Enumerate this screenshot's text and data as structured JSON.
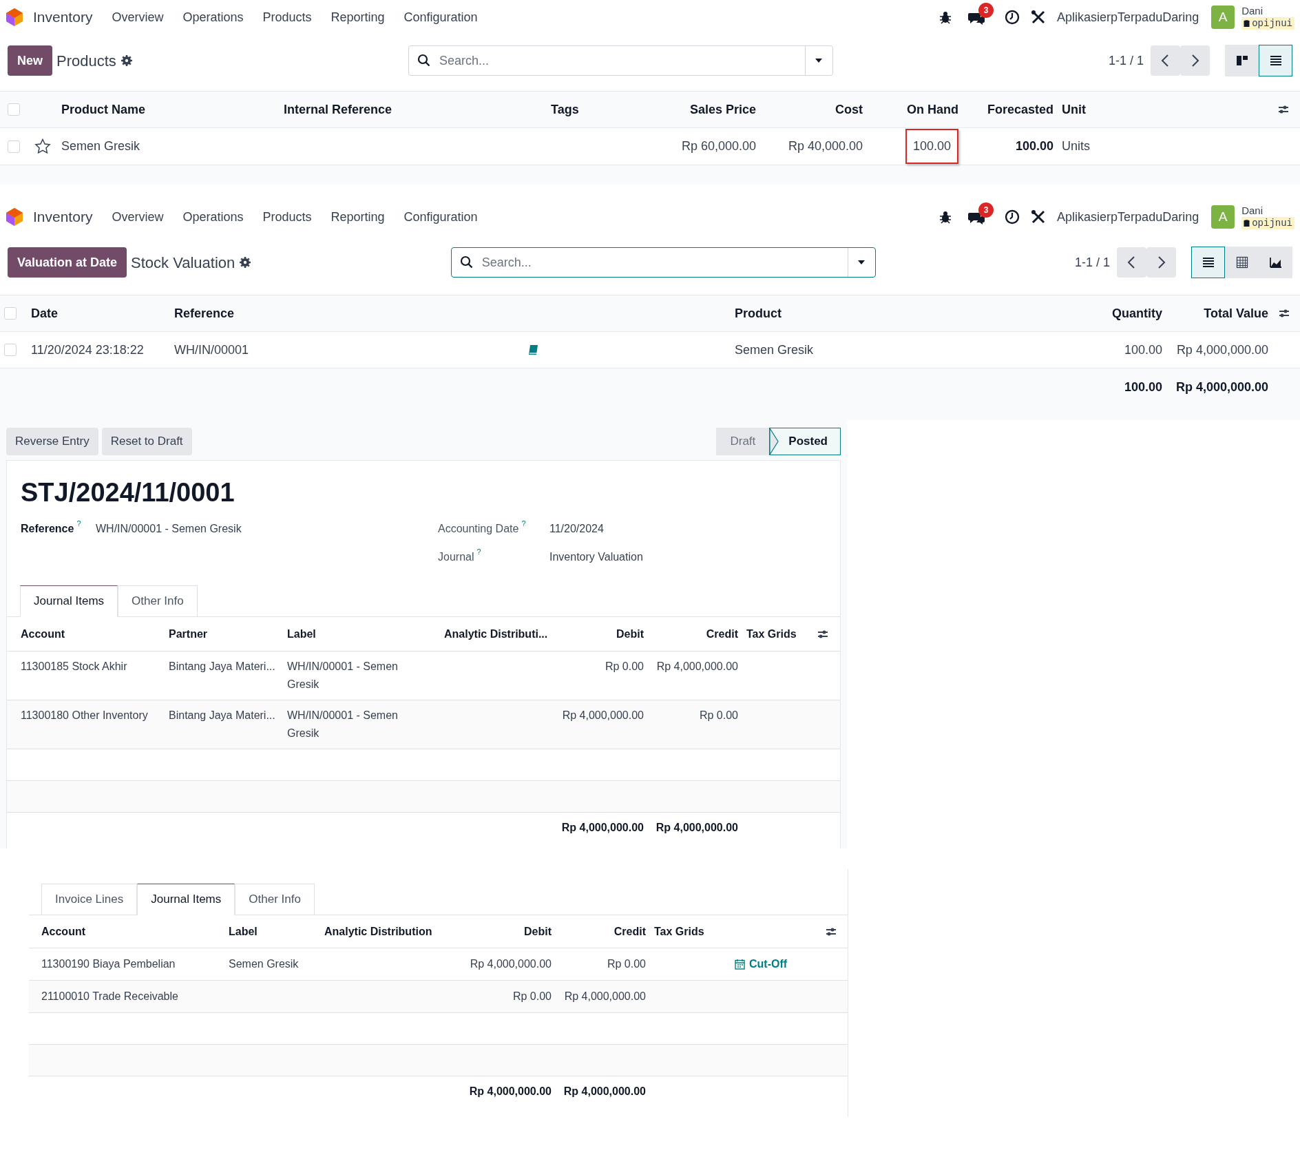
{
  "products_screen": {
    "navbar": {
      "app_name": "Inventory",
      "menus": [
        "Overview",
        "Operations",
        "Products",
        "Reporting",
        "Configuration"
      ],
      "message_count": "3",
      "company": "AplikasierpTerpaduDaring",
      "user": {
        "avatar_initial": "A",
        "name": "Dani",
        "database": "opijnui"
      }
    },
    "control_panel": {
      "primary_button": "New",
      "title": "Products",
      "search": {
        "placeholder": "Search...",
        "focused": false
      },
      "pager": "1-1 / 1",
      "view_switcher": [
        {
          "kind": "kanban",
          "selected": false
        },
        {
          "kind": "list",
          "selected": true
        }
      ]
    },
    "table": {
      "select_all_checked": false,
      "columns": [
        "Product Name",
        "Internal Reference",
        "Tags",
        "Sales Price",
        "Cost",
        "On Hand",
        "Forecasted",
        "Unit"
      ],
      "rows": [
        {
          "checked": false,
          "favorite": false,
          "product_name": "Semen Gresik",
          "sales_price": "Rp 60,000.00",
          "cost": "Rp 40,000.00",
          "on_hand": "100.00",
          "on_hand_highlighted": true,
          "forecasted": "100.00",
          "unit": "Units"
        }
      ]
    }
  },
  "valuation_screen": {
    "navbar": {
      "app_name": "Inventory",
      "menus": [
        "Overview",
        "Operations",
        "Products",
        "Reporting",
        "Configuration"
      ],
      "message_count": "3",
      "company": "AplikasierpTerpaduDaring",
      "user": {
        "avatar_initial": "A",
        "name": "Dani",
        "database": "opijnui"
      }
    },
    "control_panel": {
      "primary_button": "Valuation at Date",
      "title": "Stock Valuation",
      "search": {
        "placeholder": "Search...",
        "focused": true
      },
      "pager": "1-1 / 1",
      "view_switcher": [
        {
          "kind": "list",
          "selected": true
        },
        {
          "kind": "pivot",
          "selected": false
        },
        {
          "kind": "graph",
          "selected": false
        }
      ]
    },
    "table": {
      "select_all_checked": false,
      "columns": [
        "Date",
        "Reference",
        "Product",
        "Quantity",
        "Total Value"
      ],
      "rows": [
        {
          "checked": false,
          "date": "11/20/2024 23:18:22",
          "reference": "WH/IN/00001",
          "product": "Semen Gresik",
          "quantity": "100.00",
          "total_value": "Rp 4,000,000.00"
        }
      ],
      "totals": {
        "quantity": "100.00",
        "total_value": "Rp 4,000,000.00"
      }
    }
  },
  "journal_entry": {
    "action_buttons": [
      "Reverse Entry",
      "Reset to Draft"
    ],
    "status_steps": [
      {
        "label": "Draft",
        "selected": false
      },
      {
        "label": "Posted",
        "selected": true
      }
    ],
    "name": "STJ/2024/11/0001",
    "left_fields": [
      {
        "label": "Reference",
        "help": "?",
        "value": "WH/IN/00001 - Semen Gresik"
      }
    ],
    "right_fields": [
      {
        "label": "Accounting Date",
        "help": "?",
        "value": "11/20/2024"
      },
      {
        "label": "Journal",
        "help": "?",
        "value": "Inventory Valuation"
      }
    ],
    "tabs": [
      {
        "label": "Journal Items",
        "selected": true
      },
      {
        "label": "Other Info",
        "selected": false
      }
    ],
    "lines_table": {
      "columns": [
        "Account",
        "Partner",
        "Label",
        "Analytic Distributi...",
        "Debit",
        "Credit",
        "Tax Grids"
      ],
      "rows": [
        {
          "account": "11300185 Stock Akhir",
          "partner": "Bintang Jaya Materi...",
          "label": "WH/IN/00001 - Semen Gresik",
          "debit": "Rp 0.00",
          "credit": "Rp 4,000,000.00"
        },
        {
          "account": "11300180 Other Inventory",
          "partner": "Bintang Jaya Materi...",
          "label": "WH/IN/00001 - Semen Gresik",
          "debit": "Rp 4,000,000.00",
          "credit": "Rp 0.00"
        }
      ],
      "totals": {
        "debit": "Rp 4,000,000.00",
        "credit": "Rp 4,000,000.00"
      }
    }
  },
  "invoice_journal_items": {
    "tabs": [
      {
        "label": "Invoice Lines",
        "selected": false
      },
      {
        "label": "Journal Items",
        "selected": true
      },
      {
        "label": "Other Info",
        "selected": false
      }
    ],
    "lines_table": {
      "columns": [
        "Account",
        "Label",
        "Analytic Distribution",
        "Debit",
        "Credit",
        "Tax Grids"
      ],
      "rows": [
        {
          "account": "11300190 Biaya Pembelian",
          "label": "Semen Gresik",
          "debit": "Rp 4,000,000.00",
          "credit": "Rp 0.00",
          "cut_off": "Cut-Off"
        },
        {
          "account": "21100010 Trade Receivable",
          "debit": "Rp 0.00",
          "credit": "Rp 4,000,000.00"
        }
      ],
      "totals": {
        "debit": "Rp 4,000,000.00",
        "credit": "Rp 4,000,000.00"
      }
    }
  }
}
